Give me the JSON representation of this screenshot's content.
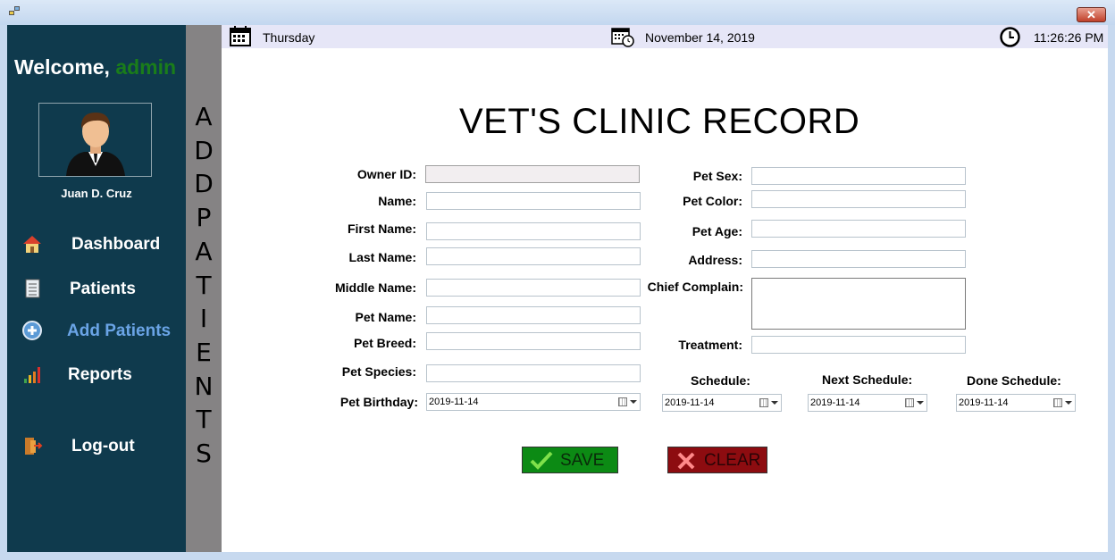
{
  "sidebar": {
    "welcome_prefix": "Welcome,",
    "welcome_user": "admin",
    "user_name": "Juan D. Cruz",
    "items": [
      {
        "label": "Dashboard",
        "icon": "house-icon"
      },
      {
        "label": "Patients",
        "icon": "notebook-icon"
      },
      {
        "label": "Add Patients",
        "icon": "plus-circle-icon",
        "active": true
      },
      {
        "label": "Reports",
        "icon": "bar-chart-icon"
      },
      {
        "label": "Log-out",
        "icon": "logout-door-icon"
      }
    ]
  },
  "vertical_banner": [
    "A",
    "D",
    "D",
    "P",
    "A",
    "T",
    "I",
    "E",
    "N",
    "T",
    "S"
  ],
  "topbar": {
    "day": "Thursday",
    "date": "November 14,  2019",
    "time": "11:26:26 PM"
  },
  "form": {
    "title": "VET'S CLINIC RECORD",
    "left": [
      {
        "label": "Owner ID:",
        "value": ""
      },
      {
        "label": "Name:",
        "value": ""
      },
      {
        "label": "First Name:",
        "value": ""
      },
      {
        "label": "Last Name:",
        "value": ""
      },
      {
        "label": "Middle Name:",
        "value": ""
      },
      {
        "label": "Pet Name:",
        "value": ""
      },
      {
        "label": "Pet Breed:",
        "value": ""
      },
      {
        "label": "Pet Species:",
        "value": ""
      },
      {
        "label": "Pet Birthday:",
        "value": "2019-11-14"
      }
    ],
    "right": [
      {
        "label": "Pet Sex:",
        "value": ""
      },
      {
        "label": "Pet Color:",
        "value": ""
      },
      {
        "label": "Pet Age:",
        "value": ""
      },
      {
        "label": "Address:",
        "value": ""
      },
      {
        "label": "Chief Complain:",
        "value": ""
      },
      {
        "label": "Treatment:",
        "value": ""
      }
    ],
    "schedules": [
      {
        "label": "Schedule:",
        "value": "2019-11-14"
      },
      {
        "label": "Next Schedule:",
        "value": "2019-11-14"
      },
      {
        "label": "Done Schedule:",
        "value": "2019-11-14"
      }
    ],
    "save_label": "SAVE",
    "clear_label": "CLEAR"
  },
  "colors": {
    "sidebar_bg": "#0f3a4d",
    "welcome_user": "#1a7d1a",
    "active_nav": "#6aa4e6",
    "save_btn": "#0c8a14",
    "clear_btn": "#8d0c10"
  }
}
